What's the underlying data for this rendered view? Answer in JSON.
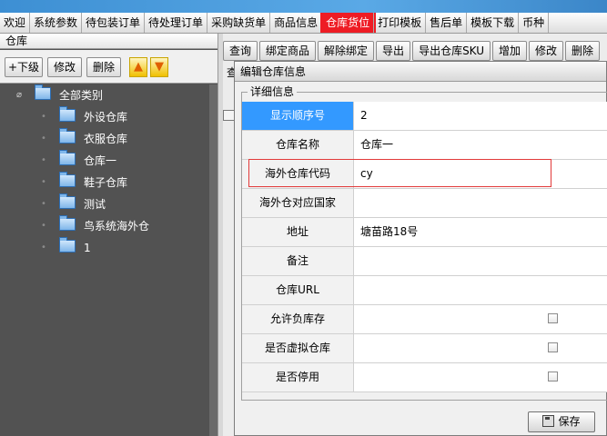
{
  "nav": {
    "items": [
      "欢迎",
      "系统参数",
      "待包装订单",
      "待处理订单",
      "采购缺货单",
      "商品信息",
      "仓库货位",
      "打印模板",
      "售后单",
      "模板下载",
      "币种"
    ],
    "active_index": 6,
    "active_color": "#ee1c24"
  },
  "left_panel": {
    "title": "仓库",
    "toolbar": {
      "add_child": "+下级",
      "edit": "修改",
      "delete": "删除"
    },
    "tree": {
      "root": "全部类别",
      "children": [
        "外设仓库",
        "衣服仓库",
        "仓库一",
        "鞋子仓库",
        "测试",
        "鸟系统海外仓",
        "1"
      ]
    }
  },
  "right_toolbar": {
    "buttons": [
      "查询",
      "绑定商品",
      "解除绑定",
      "导出",
      "导出仓库SKU",
      "增加",
      "修改",
      "删除"
    ],
    "behind_label": "查"
  },
  "dialog": {
    "title": "编辑仓库信息",
    "section": "详细信息",
    "fields": [
      {
        "label": "显示顺序号",
        "value": "2"
      },
      {
        "label": "仓库名称",
        "value": "仓库一"
      },
      {
        "label": "海外仓库代码",
        "value": "cy"
      },
      {
        "label": "海外仓对应国家",
        "value": ""
      },
      {
        "label": "地址",
        "value": "塘苗路18号"
      },
      {
        "label": "备注",
        "value": ""
      },
      {
        "label": "仓库URL",
        "value": ""
      },
      {
        "label": "允许负库存",
        "value": ""
      },
      {
        "label": "是否虚拟仓库",
        "value": ""
      },
      {
        "label": "是否停用",
        "value": ""
      }
    ],
    "save_label": "保存"
  }
}
